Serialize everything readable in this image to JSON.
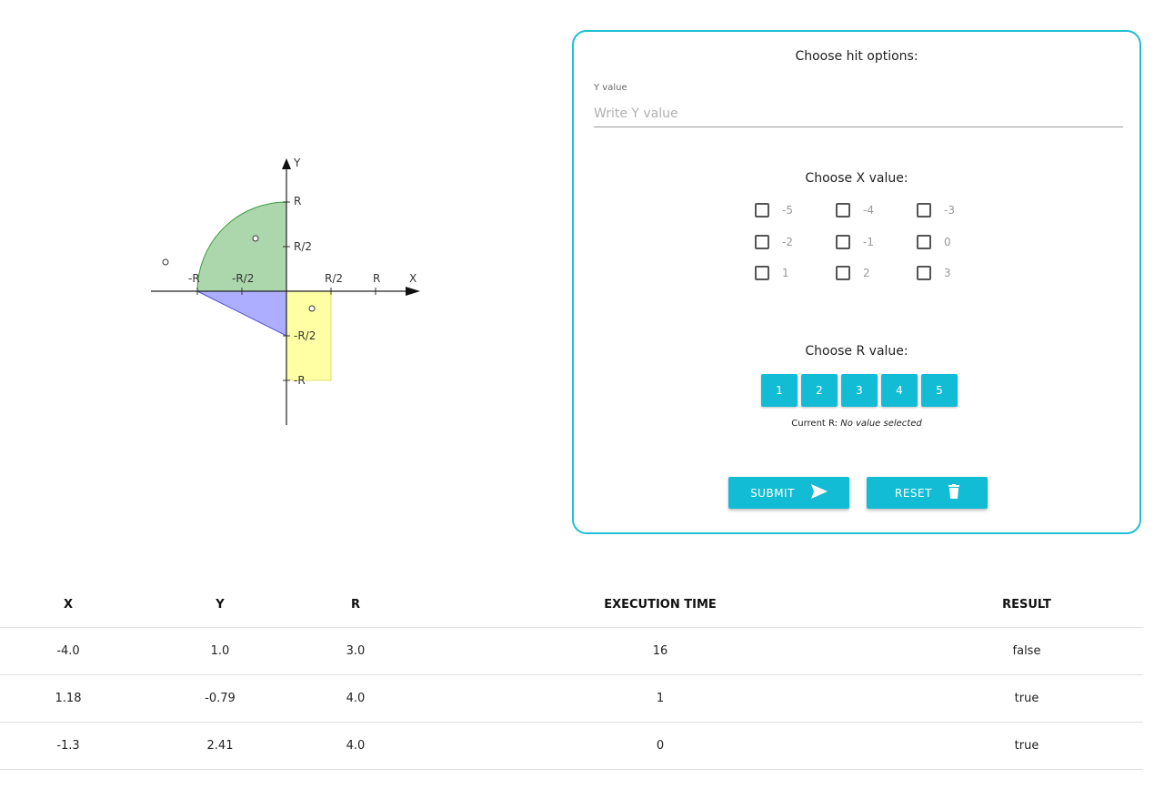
{
  "graph": {
    "axis_x": "X",
    "axis_y": "Y",
    "x_ticks": [
      "-R",
      "-R/2",
      "R/2",
      "R"
    ],
    "y_ticks": [
      "R",
      "R/2",
      "-R/2",
      "-R"
    ],
    "colors": {
      "quarter_circle": "#7fc17f",
      "triangle": "#9fa0ff",
      "rectangle": "#ffff8c"
    }
  },
  "form": {
    "title": "Choose hit options:",
    "y_label": "Y value",
    "y_placeholder": "Write Y value",
    "x_title": "Choose X value:",
    "x_options": [
      "-5",
      "-4",
      "-3",
      "-2",
      "-1",
      "0",
      "1",
      "2",
      "3"
    ],
    "r_title": "Choose R value:",
    "r_options": [
      "1",
      "2",
      "3",
      "4",
      "5"
    ],
    "current_r_label": "Current R:",
    "current_r_value": "No value selected",
    "submit_label": "SUBMIT",
    "reset_label": "RESET",
    "accent_color": "#12bcd4"
  },
  "table": {
    "headers": [
      "X",
      "Y",
      "R",
      "EXECUTION TIME",
      "RESULT"
    ],
    "rows": [
      [
        "-4.0",
        "1.0",
        "3.0",
        "16",
        "false"
      ],
      [
        "1.18",
        "-0.79",
        "4.0",
        "1",
        "true"
      ],
      [
        "-1.3",
        "2.41",
        "4.0",
        "0",
        "true"
      ]
    ]
  }
}
